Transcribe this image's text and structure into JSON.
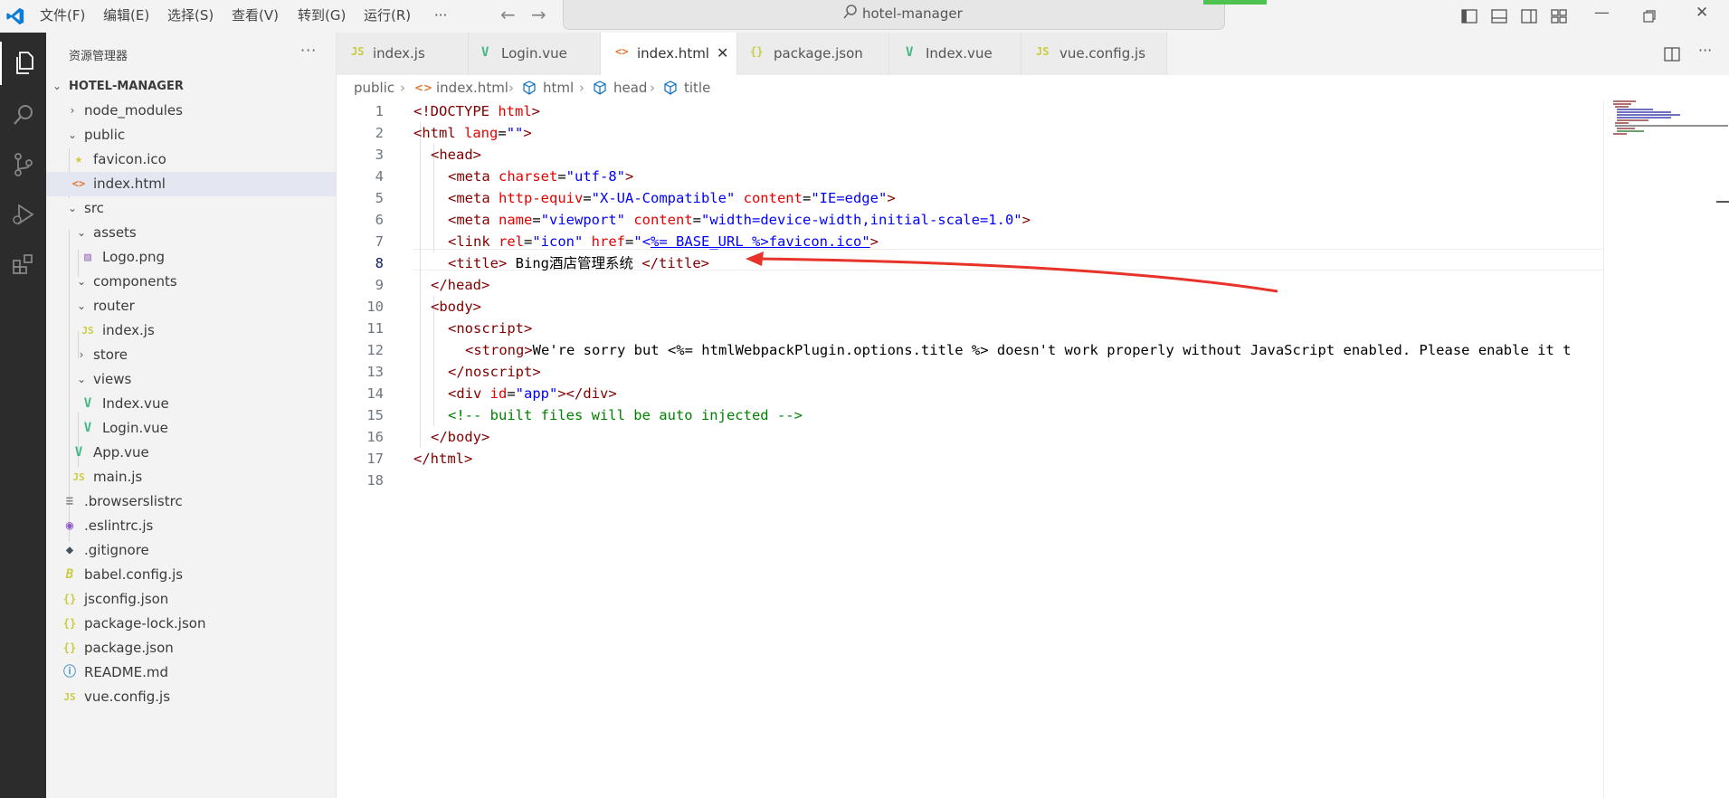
{
  "titlebar": {
    "menus": [
      "文件(F)",
      "编辑(E)",
      "选择(S)",
      "查看(V)",
      "转到(G)",
      "运行(R)",
      "···"
    ],
    "search_text": "hotel-manager"
  },
  "sidebar": {
    "title": "资源管理器",
    "more": "···",
    "project": "HOTEL-MANAGER",
    "items": [
      {
        "label": "node_modules",
        "type": "folder-closed"
      },
      {
        "label": "public",
        "type": "folder-open"
      },
      {
        "label": "favicon.ico",
        "type": "star"
      },
      {
        "label": "index.html",
        "type": "html"
      },
      {
        "label": "src",
        "type": "folder-open"
      },
      {
        "label": "assets",
        "type": "folder-open"
      },
      {
        "label": "Logo.png",
        "type": "image"
      },
      {
        "label": "components",
        "type": "folder-open"
      },
      {
        "label": "router",
        "type": "folder-open"
      },
      {
        "label": "index.js",
        "type": "js"
      },
      {
        "label": "store",
        "type": "folder-closed"
      },
      {
        "label": "views",
        "type": "folder-open"
      },
      {
        "label": "Index.vue",
        "type": "vue"
      },
      {
        "label": "Login.vue",
        "type": "vue"
      },
      {
        "label": "App.vue",
        "type": "vue"
      },
      {
        "label": "main.js",
        "type": "js"
      },
      {
        "label": ".browserslistrc",
        "type": "text"
      },
      {
        "label": ".eslintrc.js",
        "type": "eslint"
      },
      {
        "label": ".gitignore",
        "type": "git"
      },
      {
        "label": "babel.config.js",
        "type": "babel"
      },
      {
        "label": "jsconfig.json",
        "type": "json"
      },
      {
        "label": "package-lock.json",
        "type": "json"
      },
      {
        "label": "package.json",
        "type": "json"
      },
      {
        "label": "README.md",
        "type": "info"
      },
      {
        "label": "vue.config.js",
        "type": "js"
      }
    ]
  },
  "tabs": [
    {
      "label": "index.js",
      "icon": "JS"
    },
    {
      "label": "Login.vue",
      "icon": "V"
    },
    {
      "label": "index.html",
      "icon": "<>"
    },
    {
      "label": "package.json",
      "icon": "{}"
    },
    {
      "label": "Index.vue",
      "icon": "V"
    },
    {
      "label": "vue.config.js",
      "icon": "JS"
    }
  ],
  "breadcrumb": [
    "public",
    "index.html",
    "html",
    "head",
    "title"
  ],
  "editor": {
    "line_numbers": [
      "1",
      "2",
      "3",
      "4",
      "5",
      "6",
      "7",
      "8",
      "9",
      "10",
      "11",
      "12",
      "13",
      "14",
      "15",
      "16",
      "17",
      "18"
    ],
    "current_line": "8",
    "code": {
      "l1": {
        "t1": "<!DOCTYPE",
        "t2": " html",
        "t3": ">"
      },
      "l2": {
        "t1": "<html",
        "a1": " lang",
        "eq": "=",
        "v1": "\"\"",
        "t2": ">"
      },
      "l3": {
        "t1": "<head>"
      },
      "l4": {
        "t1": "<meta",
        "a1": " charset",
        "eq": "=",
        "v1": "\"utf-8\"",
        "t2": ">"
      },
      "l5": {
        "t1": "<meta",
        "a1": " http-equiv",
        "eq1": "=",
        "v1": "\"X-UA-Compatible\"",
        "a2": " content",
        "eq2": "=",
        "v2": "\"IE=edge\"",
        "t2": ">"
      },
      "l6": {
        "t1": "<meta",
        "a1": " name",
        "eq1": "=",
        "v1": "\"viewport\"",
        "a2": " content",
        "eq2": "=",
        "v2": "\"width=device-width,initial-scale=1.0\"",
        "t2": ">"
      },
      "l7": {
        "t1": "<link",
        "a1": " rel",
        "eq1": "=",
        "v1": "\"icon\"",
        "a2": " href",
        "eq2": "=",
        "v2a": "\"<",
        "v2b": "%= BASE_URL %>",
        "v2c": "favicon.ico\"",
        "t2": ">"
      },
      "l8": {
        "t1": "<title>",
        "tx": " Bing酒店管理系统 ",
        "t2": "</title>"
      },
      "l9": {
        "t1": "</head>"
      },
      "l10": {
        "t1": "<body>"
      },
      "l11": {
        "t1": "<noscript>"
      },
      "l12": {
        "t1": "<strong>",
        "tx": "We're sorry but <%= htmlWebpackPlugin.options.title %> doesn't work properly without JavaScript enabled. Please enable it t"
      },
      "l13": {
        "t1": "</noscript>"
      },
      "l14": {
        "t1": "<div",
        "a1": " id",
        "eq": "=",
        "v1": "\"app\"",
        "t2": "></div>"
      },
      "l15": {
        "c1": "<!-- built files will be auto injected -->"
      },
      "l16": {
        "t1": "</body>"
      },
      "l17": {
        "t1": "</html>"
      }
    }
  },
  "colors": {
    "annotation_arrow": "#e8332a",
    "vscode_blue": "#0a7bd6",
    "vue_green": "#41b883",
    "js_yellow": "#cbcb41",
    "html_orange": "#e37933"
  }
}
